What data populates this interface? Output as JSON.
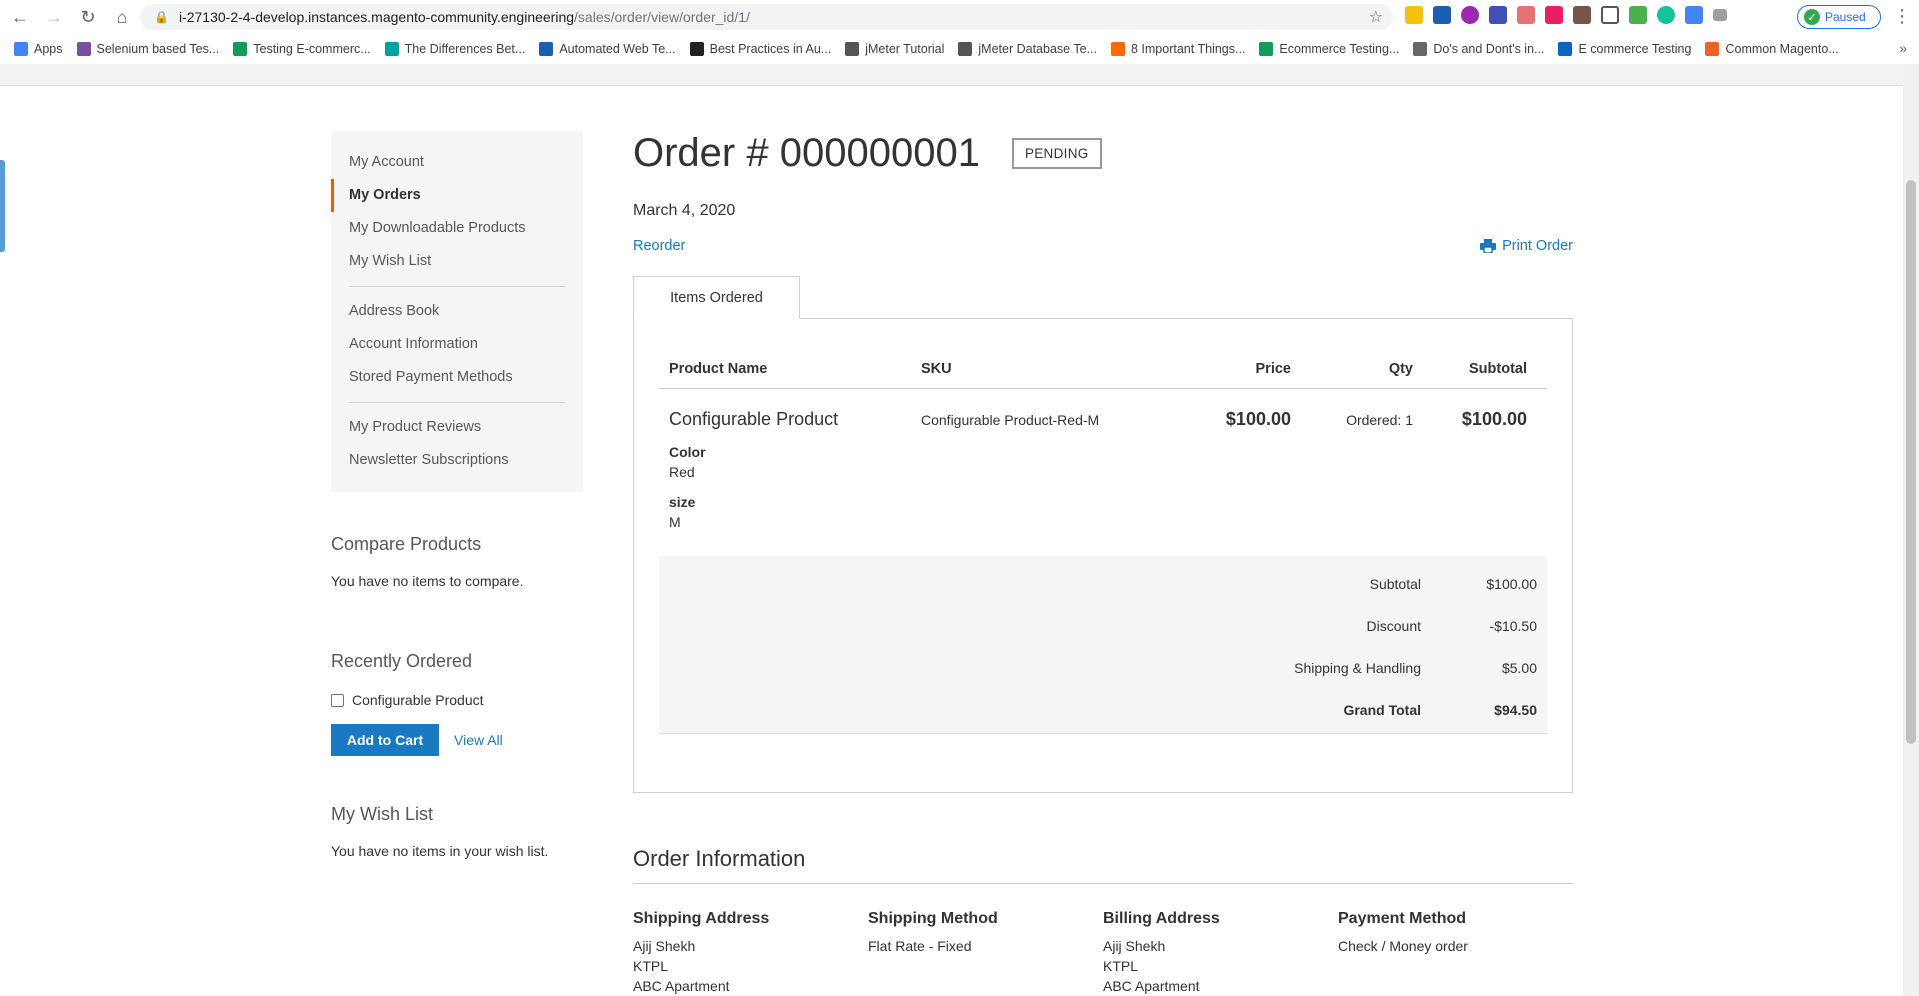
{
  "browser": {
    "url_host": "i-27130-2-4-develop.instances.magento-community.engineering",
    "url_path": "/sales/order/view/order_id/1/",
    "paused_label": "Paused",
    "bookmarks": [
      {
        "label": "Apps",
        "color": "#4285f4"
      },
      {
        "label": "Selenium based Tes...",
        "color": "#7b4fa0"
      },
      {
        "label": "Testing E-commerc...",
        "color": "#0f9d58"
      },
      {
        "label": "The Differences Bet...",
        "color": "#00a0a0"
      },
      {
        "label": "Automated Web Te...",
        "color": "#1a5fb4"
      },
      {
        "label": "Best Practices in Au...",
        "color": "#222222"
      },
      {
        "label": "jMeter Tutorial",
        "color": "#555555"
      },
      {
        "label": "jMeter Database Te...",
        "color": "#555555"
      },
      {
        "label": "8 Important Things...",
        "color": "#ff6a00"
      },
      {
        "label": "Ecommerce Testing...",
        "color": "#0f9d58"
      },
      {
        "label": "Do's and Dont's in...",
        "color": "#666666"
      },
      {
        "label": "E commerce Testing",
        "color": "#0a66c2"
      },
      {
        "label": "Common Magento...",
        "color": "#f26322"
      }
    ]
  },
  "sidebar": {
    "nav": [
      {
        "label": "My Account",
        "active": false
      },
      {
        "label": "My Orders",
        "active": true
      },
      {
        "label": "My Downloadable Products",
        "active": false
      },
      {
        "label": "My Wish List",
        "active": false
      },
      {
        "label": "Address Book",
        "active": false
      },
      {
        "label": "Account Information",
        "active": false
      },
      {
        "label": "Stored Payment Methods",
        "active": false
      },
      {
        "label": "My Product Reviews",
        "active": false
      },
      {
        "label": "Newsletter Subscriptions",
        "active": false
      }
    ],
    "compare_title": "Compare Products",
    "compare_text": "You have no items to compare.",
    "recent_title": "Recently Ordered",
    "recent_item": "Configurable Product",
    "add_to_cart": "Add to Cart",
    "view_all": "View All",
    "wishlist_title": "My Wish List",
    "wishlist_text": "You have no items in your wish list."
  },
  "order": {
    "title": "Order # 000000001",
    "status": "PENDING",
    "date": "March 4, 2020",
    "reorder": "Reorder",
    "print": "Print Order",
    "tab": "Items Ordered",
    "columns": {
      "name": "Product Name",
      "sku": "SKU",
      "price": "Price",
      "qty": "Qty",
      "subtotal": "Subtotal"
    },
    "item": {
      "name": "Configurable Product",
      "sku": "Configurable Product-Red-M",
      "price": "$100.00",
      "qty": "Ordered: 1",
      "subtotal": "$100.00",
      "options": [
        {
          "label": "Color",
          "value": "Red"
        },
        {
          "label": "size",
          "value": "M"
        }
      ]
    },
    "totals": [
      {
        "label": "Subtotal",
        "value": "$100.00"
      },
      {
        "label": "Discount",
        "value": "-$10.50"
      },
      {
        "label": "Shipping & Handling",
        "value": "$5.00"
      },
      {
        "label": "Grand Total",
        "value": "$94.50"
      }
    ]
  },
  "order_info": {
    "title": "Order Information",
    "shipping_address": {
      "title": "Shipping Address",
      "lines": [
        "Ajij Shekh",
        "KTPL",
        "ABC Apartment"
      ]
    },
    "shipping_method": {
      "title": "Shipping Method",
      "lines": [
        "Flat Rate - Fixed"
      ]
    },
    "billing_address": {
      "title": "Billing Address",
      "lines": [
        "Ajij Shekh",
        "KTPL",
        "ABC Apartment"
      ]
    },
    "payment_method": {
      "title": "Payment Method",
      "lines": [
        "Check / Money order"
      ]
    }
  }
}
